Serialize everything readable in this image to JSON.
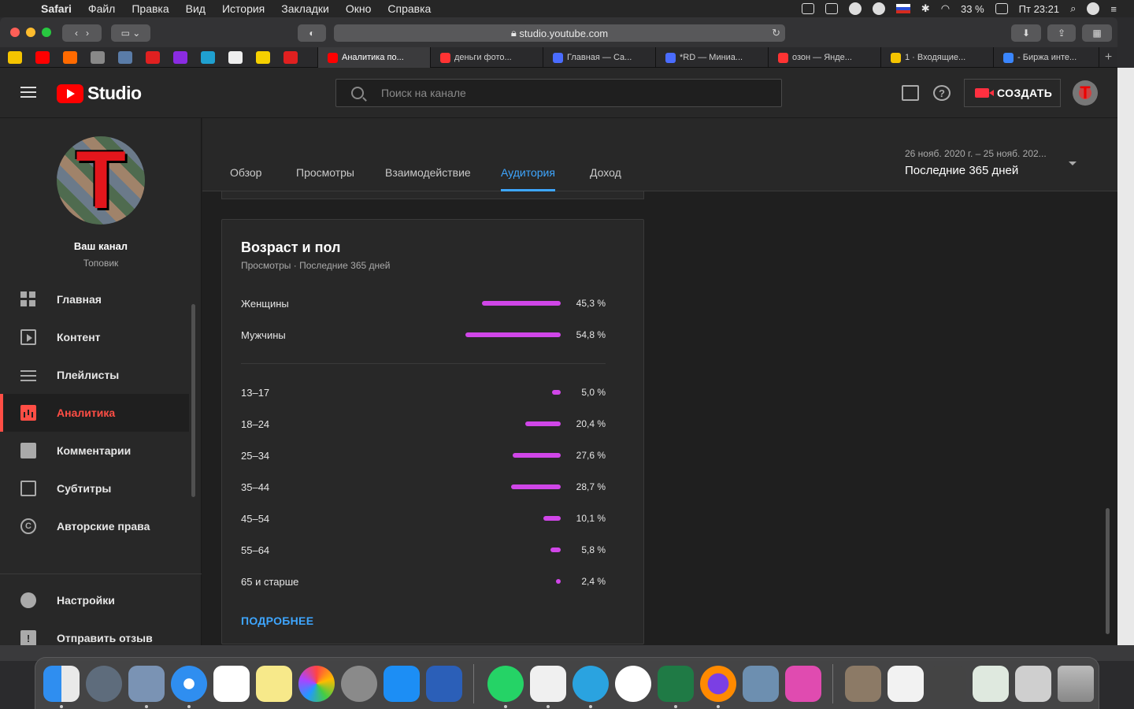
{
  "menubar": {
    "app": "Safari",
    "items": [
      "Файл",
      "Правка",
      "Вид",
      "История",
      "Закладки",
      "Окно",
      "Справка"
    ],
    "battery": "33 %",
    "clock": "Пт 23:21"
  },
  "browser": {
    "url": "studio.youtube.com",
    "tabs": [
      {
        "title": "Аналитика по...",
        "color": "#ff0000"
      },
      {
        "title": "деньги фото...",
        "color": "#ff3333"
      },
      {
        "title": "Главная — Са...",
        "color": "#4a6cff"
      },
      {
        "title": "*RD — Миниа...",
        "color": "#4a6cff"
      },
      {
        "title": "озон — Янде...",
        "color": "#ff3333"
      },
      {
        "title": "1 · Входящие...",
        "color": "#f5c400"
      },
      {
        "title": "- Биржа инте...",
        "color": "#3a86ff"
      }
    ]
  },
  "studio": {
    "logo_text": "Studio",
    "search_placeholder": "Поиск на канале",
    "create_label": "СОЗДАТЬ",
    "help_glyph": "?"
  },
  "sidebar": {
    "channel_title": "Ваш канал",
    "channel_name": "Топовик",
    "items": [
      {
        "label": "Главная"
      },
      {
        "label": "Контент"
      },
      {
        "label": "Плейлисты"
      },
      {
        "label": "Аналитика"
      },
      {
        "label": "Комментарии"
      },
      {
        "label": "Субтитры"
      },
      {
        "label": "Авторские права"
      }
    ],
    "bottom_items": [
      {
        "label": "Настройки"
      },
      {
        "label": "Отправить отзыв"
      }
    ]
  },
  "analytics": {
    "tabs": [
      "Обзор",
      "Просмотры",
      "Взаимодействие",
      "Аудитория",
      "Доход"
    ],
    "active_tab": "Аудитория",
    "date_range": "26 нояб. 2020 г. – 25 нояб. 202...",
    "date_preset": "Последние 365 дней"
  },
  "card": {
    "title": "Возраст и пол",
    "subtitle": "Просмотры · Последние 365 дней",
    "gender": [
      {
        "label": "Женщины",
        "value": "45,3 %",
        "pct": 45.3
      },
      {
        "label": "Мужчины",
        "value": "54,8 %",
        "pct": 54.8
      }
    ],
    "age": [
      {
        "label": "13–17",
        "value": "5,0 %",
        "pct": 5.0
      },
      {
        "label": "18–24",
        "value": "20,4 %",
        "pct": 20.4
      },
      {
        "label": "25–34",
        "value": "27,6 %",
        "pct": 27.6
      },
      {
        "label": "35–44",
        "value": "28,7 %",
        "pct": 28.7
      },
      {
        "label": "45–54",
        "value": "10,1 %",
        "pct": 10.1
      },
      {
        "label": "55–64",
        "value": "5,8 %",
        "pct": 5.8
      },
      {
        "label": "65 и старше",
        "value": "2,4 %",
        "pct": 2.4
      }
    ],
    "more_label": "ПОДРОБНЕЕ",
    "bar_color": "#d046e8"
  }
}
